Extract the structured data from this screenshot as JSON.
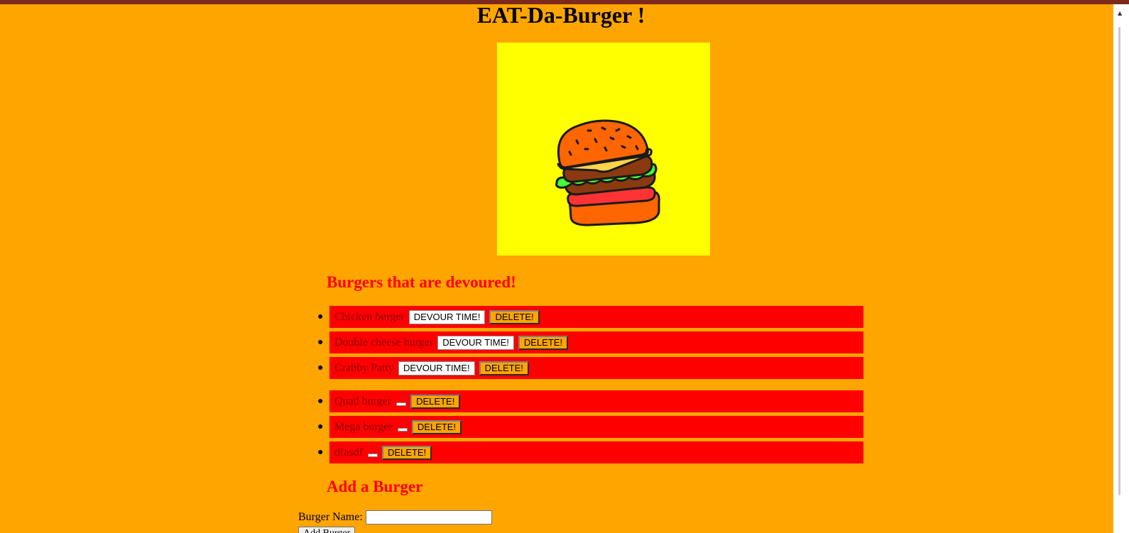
{
  "page": {
    "title": "EAT-Da-Burger !",
    "background_color": "#ffa500",
    "accent_color": "#ff0000",
    "image_panel_color": "#ffff00"
  },
  "devoured_section": {
    "heading": "Burgers that are devoured!"
  },
  "list_a": [
    {
      "name": "Chicken burger",
      "devour_label": "DEVOUR TIME!",
      "delete_label": "DELETE!"
    },
    {
      "name": "Double cheese burger",
      "devour_label": "DEVOUR TIME!",
      "delete_label": "DELETE!"
    },
    {
      "name": "Crabby Patty",
      "devour_label": "DEVOUR TIME!",
      "delete_label": "DELETE!"
    }
  ],
  "list_b": [
    {
      "name": "Quad burger",
      "delete_label": "DELETE!"
    },
    {
      "name": "Mega burger",
      "delete_label": "DELETE!"
    },
    {
      "name": "dfasdf",
      "delete_label": "DELETE!"
    }
  ],
  "add_section": {
    "heading": "Add a Burger",
    "name_label": "Burger Name:",
    "name_value": "",
    "submit_label": "Add Burger"
  },
  "icons": {
    "hero_image": "burger-illustration-icon",
    "bullet": "bullet-dot-icon",
    "scroll_up": "scroll-up-arrow-icon"
  }
}
